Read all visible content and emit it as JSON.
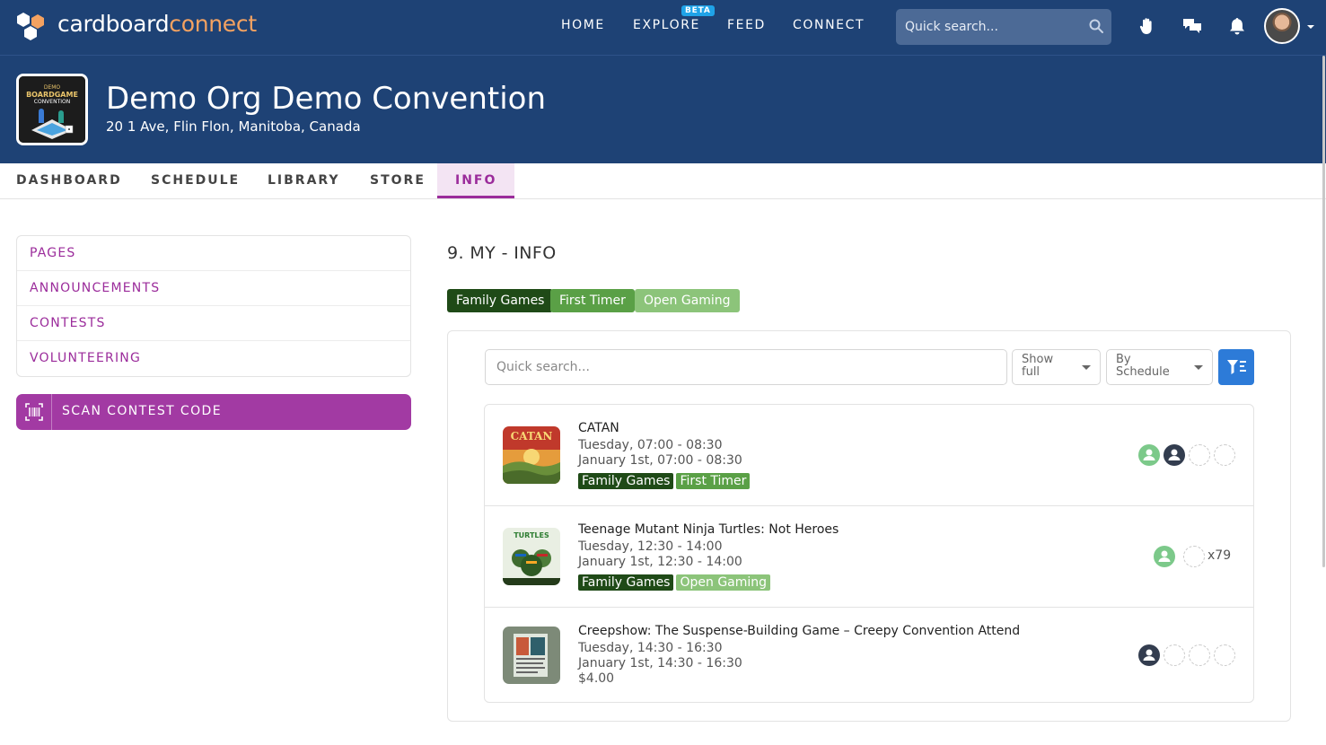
{
  "brand": {
    "part1": "cardboard",
    "part2": "connect"
  },
  "nav": {
    "home": "HOME",
    "explore": "EXPLORE",
    "explore_badge": "BETA",
    "feed": "FEED",
    "connect": "CONNECT"
  },
  "top_search": {
    "placeholder": "Quick search..."
  },
  "org": {
    "title": "Demo Org Demo Convention",
    "address": "20 1 Ave, Flin Flon, Manitoba, Canada",
    "logo_text": [
      "DEMO",
      "BOARDGAME",
      "CONVENTION"
    ]
  },
  "tabs": [
    {
      "label": "DASHBOARD"
    },
    {
      "label": "SCHEDULE"
    },
    {
      "label": "LIBRARY"
    },
    {
      "label": "STORE"
    },
    {
      "label": "INFO",
      "active": true
    }
  ],
  "sidebar": {
    "items": [
      {
        "label": "PAGES"
      },
      {
        "label": "ANNOUNCEMENTS"
      },
      {
        "label": "CONTESTS"
      },
      {
        "label": "VOLUNTEERING"
      }
    ],
    "scan_button": "SCAN CONTEST CODE"
  },
  "main": {
    "title": "9. MY - INFO",
    "chips": [
      {
        "label": "Family Games",
        "color": "#1f4a17"
      },
      {
        "label": "First Timer",
        "color": "#5aa046"
      },
      {
        "label": "Open Gaming",
        "color": "#8cc47a"
      }
    ],
    "filter": {
      "search_placeholder": "Quick search...",
      "show": {
        "line1": "Show",
        "line2": "full"
      },
      "order": {
        "line1": "By",
        "line2": "Schedule"
      }
    },
    "events": [
      {
        "title": "CATAN",
        "thumb_text": "CATAN",
        "time": "Tuesday, 07:00 - 08:30",
        "date": "January 1st, 07:00 - 08:30",
        "tags": [
          {
            "label": "Family Games",
            "color": "#1f4a17"
          },
          {
            "label": "First Timer",
            "color": "#5aa046"
          }
        ]
      },
      {
        "title": "Teenage Mutant Ninja Turtles: Not Heroes",
        "thumb_text": "TURTLES",
        "time": "Tuesday, 12:30 - 14:00",
        "date": "January 1st, 12:30 - 14:00",
        "tags": [
          {
            "label": "Family Games",
            "color": "#1f4a17"
          },
          {
            "label": "Open Gaming",
            "color": "#8cc47a"
          }
        ],
        "extra_count": "x79"
      },
      {
        "title": "Creepshow: The Suspense-Building Game – Creepy Convention Attend",
        "time": "Tuesday, 14:30 - 16:30",
        "date": "January 1st, 14:30 - 16:30",
        "price": "$4.00"
      }
    ]
  },
  "icons": {
    "wave": "wave-icon",
    "chat": "chat-icon",
    "bell": "bell-icon",
    "search": "search-icon",
    "filter": "filter-icon",
    "scan": "scan-icon",
    "user": "user-icon"
  }
}
